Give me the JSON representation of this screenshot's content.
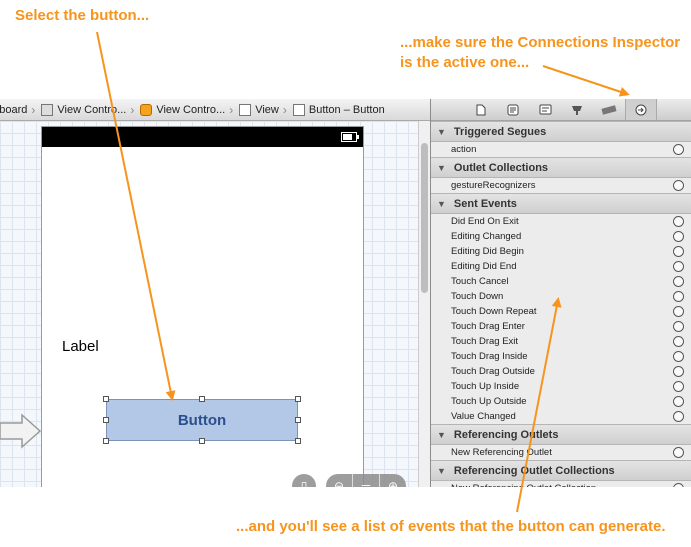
{
  "callouts": {
    "select_button": "Select the button...",
    "connections_line1": "...make sure the Connections Inspector",
    "connections_line2": "is the active one...",
    "events_list": "...and you'll see a list of events that the button can generate."
  },
  "colors": {
    "callout": "#f7941d",
    "button_fill": "#b3c8e6",
    "button_text": "#2c4f8c"
  },
  "breadcrumb": {
    "items": [
      {
        "label": "oryboard",
        "icon": ""
      },
      {
        "label": "View Contro...",
        "icon": "view-controller-scene-icon"
      },
      {
        "label": "View Contro...",
        "icon": "view-controller-icon"
      },
      {
        "label": "View",
        "icon": "view-icon"
      },
      {
        "label": "Button – Button",
        "icon": "button-icon"
      }
    ]
  },
  "canvas": {
    "label_text": "Label",
    "button_text": "Button",
    "battery_level": 0.75
  },
  "inspector": {
    "toolbar_icons": [
      "file-inspector-icon",
      "quick-help-icon",
      "identity-inspector-icon",
      "attributes-inspector-icon",
      "size-inspector-icon",
      "connections-inspector-icon"
    ],
    "active_tab": "connections-inspector-icon",
    "sections": [
      {
        "title": "Triggered Segues",
        "items": [
          "action"
        ]
      },
      {
        "title": "Outlet Collections",
        "items": [
          "gestureRecognizers"
        ]
      },
      {
        "title": "Sent Events",
        "items": [
          "Did End On Exit",
          "Editing Changed",
          "Editing Did Begin",
          "Editing Did End",
          "Touch Cancel",
          "Touch Down",
          "Touch Down Repeat",
          "Touch Drag Enter",
          "Touch Drag Exit",
          "Touch Drag Inside",
          "Touch Drag Outside",
          "Touch Up Inside",
          "Touch Up Outside",
          "Value Changed"
        ]
      },
      {
        "title": "Referencing Outlets",
        "items": [
          "New Referencing Outlet"
        ]
      },
      {
        "title": "Referencing Outlet Collections",
        "items": [
          "New Referencing Outlet Collection"
        ]
      }
    ]
  }
}
